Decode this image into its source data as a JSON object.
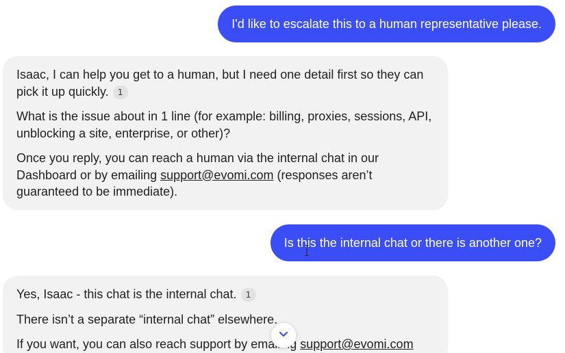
{
  "messages": {
    "user_1": "I'd like to escalate this to a human representative please.",
    "bot_1": {
      "p1": "Isaac, I can help you get to a human, but I need one detail first so they can pick it up quickly.",
      "p1_cite": "1",
      "p2": "What is the issue about in 1 line (for example: billing, proxies, sessions, API, unblocking a site, enterprise, or other)?",
      "p3_before": "Once you reply, you can reach a human via the internal chat in our Dashboard or by emailing ",
      "p3_link": "support@evomi.com",
      "p3_after": " (responses aren’t guaranteed to be immediate)."
    },
    "user_2": "Is this the internal chat or there is another one?",
    "bot_2": {
      "p1": "Yes, Isaac - this chat is the internal chat.",
      "p1_cite": "1",
      "p2": "There isn’t a separate “internal chat” elsewhere.",
      "p3_before": "If you want, you can also reach support by emailing ",
      "p3_link": "support@evomi.com"
    }
  },
  "icons": {
    "scroll_down": "chevron-down-icon",
    "cursor": "text-cursor-icon"
  },
  "colors": {
    "user_bubble": "#3b4ef5",
    "bot_bubble": "#f2f2f2",
    "chevron": "#3b4ef5"
  }
}
